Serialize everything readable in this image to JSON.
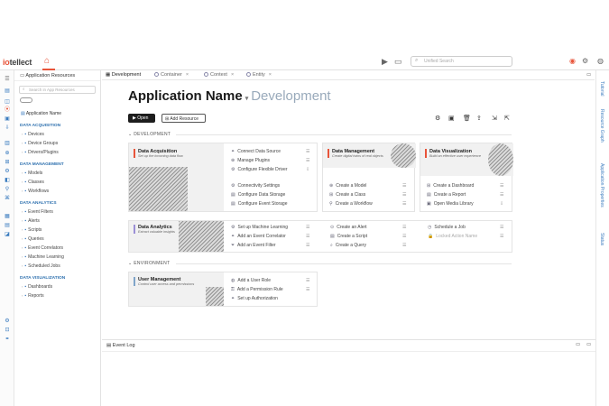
{
  "app": {
    "logo_prefix": "io",
    "logo_suffix": "tellect"
  },
  "topbar": {
    "search_placeholder": "Unified Search"
  },
  "resources": {
    "title": "Application Resources",
    "search_placeholder": "Search in App Resources",
    "root": "Application Name",
    "sections": [
      {
        "title": "DATA ACQUISITION",
        "items": [
          "Devices",
          "Device Groups",
          "Drivers/Plugins"
        ]
      },
      {
        "title": "DATA MANAGEMENT",
        "items": [
          "Models",
          "Classes",
          "Workflows"
        ]
      },
      {
        "title": "DATA ANALYTICS",
        "items": [
          "Event Filters",
          "Alerts",
          "Scripts",
          "Queries",
          "Event Correlators",
          "Machine Learning",
          "Scheduled Jobs"
        ]
      },
      {
        "title": "DATA VISUALIZATION",
        "items": [
          "Dashboards",
          "Reports"
        ]
      }
    ]
  },
  "tabs": [
    "Development",
    "Container",
    "Context",
    "Entity"
  ],
  "right_rail": [
    "Tutorial",
    "Resource Graph",
    "Application Properties",
    "Status"
  ],
  "main": {
    "title": "Application Name",
    "subtitle": "Development",
    "open_label": "Open",
    "add_label": "Add Resource",
    "section_dev": "DEVELOPMENT",
    "section_env": "ENVIRONMENT"
  },
  "cards": {
    "acq": {
      "title": "Data Acquisition",
      "subtitle": "Set up the incoming data flow",
      "actions": [
        "Connect Data Source",
        "Manage Plugins",
        "Configure Flexible Driver",
        "Connectivity Settings",
        "Configure Data Storage",
        "Configure Event Storage"
      ]
    },
    "mgmt": {
      "title": "Data Management",
      "subtitle": "Create digital twins of real objects",
      "actions": [
        "Create a Model",
        "Create a Class",
        "Create a Workflow"
      ]
    },
    "vis": {
      "title": "Data Visualization",
      "subtitle": "Build an effective user experience",
      "actions": [
        "Create a Dashboard",
        "Create a Report",
        "Open Media Library"
      ]
    },
    "ana": {
      "title": "Data Analytics",
      "subtitle": "Extract valuable insights",
      "actions": [
        "Set up Machine Learning",
        "Add an Event Correlator",
        "Add an Event Filter",
        "Create an Alert",
        "Create a Script",
        "Create a Query",
        "Schedule a Job",
        "Locked Action Name"
      ]
    },
    "user": {
      "title": "User Management",
      "subtitle": "Control user access and permissions",
      "actions": [
        "Add a User Role",
        "Add a Permission Rule",
        "Set up Authorization"
      ]
    }
  },
  "bottom": {
    "label": "Event Log"
  }
}
